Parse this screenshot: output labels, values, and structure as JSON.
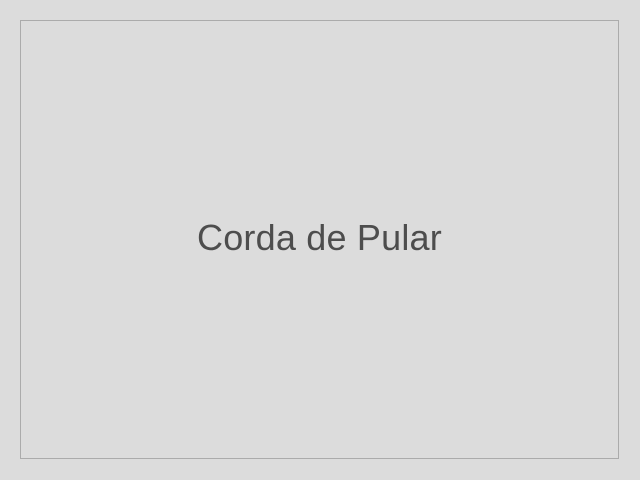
{
  "placeholder": {
    "caption": "Corda de Pular"
  },
  "colors": {
    "background": "#dcdcdc",
    "border": "#ababab",
    "text": "#4d4d4d"
  }
}
